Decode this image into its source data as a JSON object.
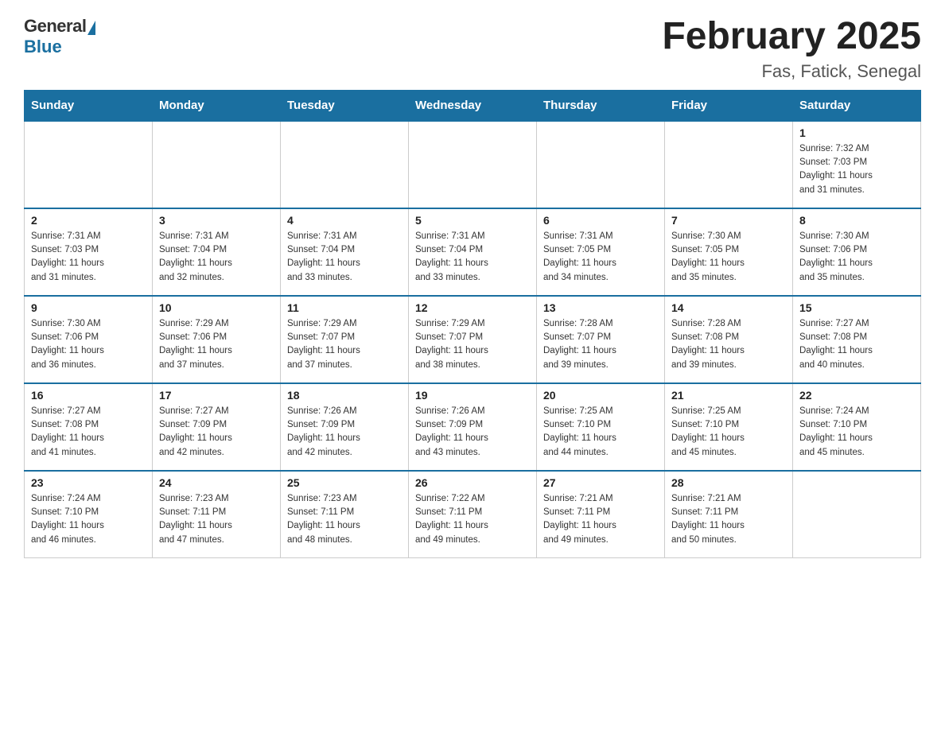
{
  "header": {
    "logo_general": "General",
    "logo_blue": "Blue",
    "title": "February 2025",
    "subtitle": "Fas, Fatick, Senegal"
  },
  "days_of_week": [
    "Sunday",
    "Monday",
    "Tuesday",
    "Wednesday",
    "Thursday",
    "Friday",
    "Saturday"
  ],
  "weeks": [
    [
      {
        "day": "",
        "info": ""
      },
      {
        "day": "",
        "info": ""
      },
      {
        "day": "",
        "info": ""
      },
      {
        "day": "",
        "info": ""
      },
      {
        "day": "",
        "info": ""
      },
      {
        "day": "",
        "info": ""
      },
      {
        "day": "1",
        "info": "Sunrise: 7:32 AM\nSunset: 7:03 PM\nDaylight: 11 hours\nand 31 minutes."
      }
    ],
    [
      {
        "day": "2",
        "info": "Sunrise: 7:31 AM\nSunset: 7:03 PM\nDaylight: 11 hours\nand 31 minutes."
      },
      {
        "day": "3",
        "info": "Sunrise: 7:31 AM\nSunset: 7:04 PM\nDaylight: 11 hours\nand 32 minutes."
      },
      {
        "day": "4",
        "info": "Sunrise: 7:31 AM\nSunset: 7:04 PM\nDaylight: 11 hours\nand 33 minutes."
      },
      {
        "day": "5",
        "info": "Sunrise: 7:31 AM\nSunset: 7:04 PM\nDaylight: 11 hours\nand 33 minutes."
      },
      {
        "day": "6",
        "info": "Sunrise: 7:31 AM\nSunset: 7:05 PM\nDaylight: 11 hours\nand 34 minutes."
      },
      {
        "day": "7",
        "info": "Sunrise: 7:30 AM\nSunset: 7:05 PM\nDaylight: 11 hours\nand 35 minutes."
      },
      {
        "day": "8",
        "info": "Sunrise: 7:30 AM\nSunset: 7:06 PM\nDaylight: 11 hours\nand 35 minutes."
      }
    ],
    [
      {
        "day": "9",
        "info": "Sunrise: 7:30 AM\nSunset: 7:06 PM\nDaylight: 11 hours\nand 36 minutes."
      },
      {
        "day": "10",
        "info": "Sunrise: 7:29 AM\nSunset: 7:06 PM\nDaylight: 11 hours\nand 37 minutes."
      },
      {
        "day": "11",
        "info": "Sunrise: 7:29 AM\nSunset: 7:07 PM\nDaylight: 11 hours\nand 37 minutes."
      },
      {
        "day": "12",
        "info": "Sunrise: 7:29 AM\nSunset: 7:07 PM\nDaylight: 11 hours\nand 38 minutes."
      },
      {
        "day": "13",
        "info": "Sunrise: 7:28 AM\nSunset: 7:07 PM\nDaylight: 11 hours\nand 39 minutes."
      },
      {
        "day": "14",
        "info": "Sunrise: 7:28 AM\nSunset: 7:08 PM\nDaylight: 11 hours\nand 39 minutes."
      },
      {
        "day": "15",
        "info": "Sunrise: 7:27 AM\nSunset: 7:08 PM\nDaylight: 11 hours\nand 40 minutes."
      }
    ],
    [
      {
        "day": "16",
        "info": "Sunrise: 7:27 AM\nSunset: 7:08 PM\nDaylight: 11 hours\nand 41 minutes."
      },
      {
        "day": "17",
        "info": "Sunrise: 7:27 AM\nSunset: 7:09 PM\nDaylight: 11 hours\nand 42 minutes."
      },
      {
        "day": "18",
        "info": "Sunrise: 7:26 AM\nSunset: 7:09 PM\nDaylight: 11 hours\nand 42 minutes."
      },
      {
        "day": "19",
        "info": "Sunrise: 7:26 AM\nSunset: 7:09 PM\nDaylight: 11 hours\nand 43 minutes."
      },
      {
        "day": "20",
        "info": "Sunrise: 7:25 AM\nSunset: 7:10 PM\nDaylight: 11 hours\nand 44 minutes."
      },
      {
        "day": "21",
        "info": "Sunrise: 7:25 AM\nSunset: 7:10 PM\nDaylight: 11 hours\nand 45 minutes."
      },
      {
        "day": "22",
        "info": "Sunrise: 7:24 AM\nSunset: 7:10 PM\nDaylight: 11 hours\nand 45 minutes."
      }
    ],
    [
      {
        "day": "23",
        "info": "Sunrise: 7:24 AM\nSunset: 7:10 PM\nDaylight: 11 hours\nand 46 minutes."
      },
      {
        "day": "24",
        "info": "Sunrise: 7:23 AM\nSunset: 7:11 PM\nDaylight: 11 hours\nand 47 minutes."
      },
      {
        "day": "25",
        "info": "Sunrise: 7:23 AM\nSunset: 7:11 PM\nDaylight: 11 hours\nand 48 minutes."
      },
      {
        "day": "26",
        "info": "Sunrise: 7:22 AM\nSunset: 7:11 PM\nDaylight: 11 hours\nand 49 minutes."
      },
      {
        "day": "27",
        "info": "Sunrise: 7:21 AM\nSunset: 7:11 PM\nDaylight: 11 hours\nand 49 minutes."
      },
      {
        "day": "28",
        "info": "Sunrise: 7:21 AM\nSunset: 7:11 PM\nDaylight: 11 hours\nand 50 minutes."
      },
      {
        "day": "",
        "info": ""
      }
    ]
  ]
}
